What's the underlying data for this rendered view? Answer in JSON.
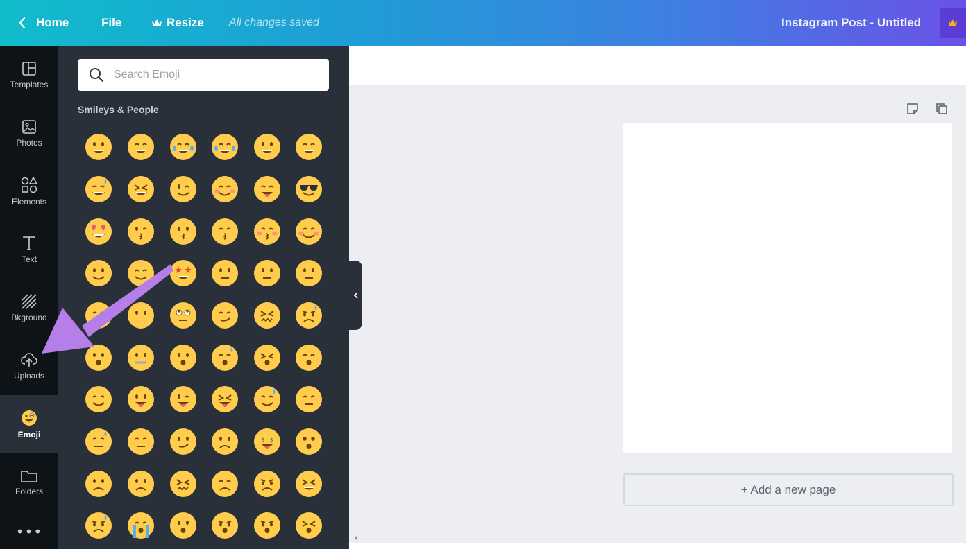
{
  "topbar": {
    "home_label": "Home",
    "file_label": "File",
    "resize_label": "Resize",
    "saved_status": "All changes saved",
    "document_title": "Instagram Post - Untitled"
  },
  "nav": {
    "items": [
      {
        "label": "Templates",
        "icon": "templates-icon"
      },
      {
        "label": "Photos",
        "icon": "photos-icon"
      },
      {
        "label": "Elements",
        "icon": "elements-icon"
      },
      {
        "label": "Text",
        "icon": "text-icon"
      },
      {
        "label": "Bkground",
        "icon": "background-icon"
      },
      {
        "label": "Uploads",
        "icon": "upload-cloud-icon"
      },
      {
        "label": "Emoji",
        "icon": "emoji-icon",
        "active": true
      },
      {
        "label": "Folders",
        "icon": "folder-icon"
      }
    ],
    "more_label": "•••"
  },
  "emoji_panel": {
    "search_placeholder": "Search Emoji",
    "section_title": "Smileys & People",
    "emojis": [
      "grinning",
      "grin",
      "joy",
      "rofl",
      "smiley",
      "smile",
      "sweat-smile",
      "laughing",
      "wink",
      "blush",
      "yum",
      "sunglasses",
      "heart-eyes",
      "kissing-heart",
      "kissing",
      "kissing-smiling-eyes",
      "kissing-closed-eyes",
      "relaxed",
      "slight-smile",
      "hugging",
      "star-struck",
      "thinking",
      "raised-eyebrow",
      "neutral",
      "expressionless",
      "no-mouth",
      "rolling-eyes",
      "smirk",
      "persevere",
      "disappointed-relieved",
      "open-mouth",
      "zipper-mouth",
      "hushed",
      "sleepy",
      "tired",
      "sleeping",
      "relieved",
      "stuck-out-tongue",
      "stuck-out-tongue-winking",
      "stuck-out-tongue-closed-eyes",
      "drooling",
      "unamused",
      "sweat",
      "pensive",
      "confused",
      "upside-down",
      "money-mouth",
      "astonished",
      "frowning",
      "slight-frown",
      "confounded",
      "disappointed",
      "worried",
      "triumph",
      "cry",
      "sob",
      "frowning-open",
      "anguished",
      "fearful",
      "weary"
    ]
  },
  "canvas": {
    "add_page_label": "+ Add a new page"
  },
  "colors": {
    "topbar_gradient_start": "#10bccb",
    "topbar_gradient_end": "#6a52e6",
    "nav_bg": "#0e1318",
    "panel_bg": "#293039",
    "emoji_yellow": "#ffcc4d",
    "annotation_arrow": "#b57ee8"
  }
}
